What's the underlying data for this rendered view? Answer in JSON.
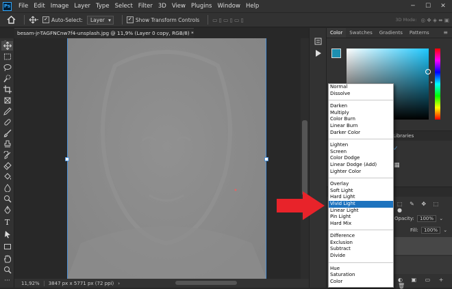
{
  "menubar": {
    "logo": "Ps",
    "items": [
      "File",
      "Edit",
      "Image",
      "Layer",
      "Type",
      "Select",
      "Filter",
      "3D",
      "View",
      "Plugins",
      "Window",
      "Help"
    ],
    "window_controls": [
      "─",
      "☐",
      "✕"
    ]
  },
  "options_bar": {
    "auto_select_label": "Auto-Select:",
    "layer_select": "Layer",
    "show_transform_label": "Show Transform Controls",
    "mode_3d_label": "3D Mode:"
  },
  "document": {
    "tab_title": "besam-jr-TAGFNCnw7f4-unsplash.jpg @ 11,9% (Layer 0 copy, RGB/8) *",
    "close": "×"
  },
  "status": {
    "zoom": "11,92%",
    "doc_size": "3847 px x 5771 px (72 ppi)"
  },
  "panels": {
    "color_tabs": [
      "Color",
      "Swatches",
      "Gradients",
      "Patterns"
    ],
    "libraries_tab": "Libraries",
    "opacity_label": "Opacity:",
    "opacity_value": "100%",
    "fill_label": "Fill:",
    "fill_value": "100%"
  },
  "colors": {
    "accent": "#1e73be",
    "foreground_swatch": "#1d8fb0",
    "arrow": "#e8232a"
  },
  "blend_menu": {
    "groups": [
      [
        "Normal",
        "Dissolve"
      ],
      [
        "Darken",
        "Multiply",
        "Color Burn",
        "Linear Burn",
        "Darker Color"
      ],
      [
        "Lighten",
        "Screen",
        "Color Dodge",
        "Linear Dodge (Add)",
        "Lighter Color"
      ],
      [
        "Overlay",
        "Soft Light",
        "Hard Light",
        "Vivid Light",
        "Linear Light",
        "Pin Light",
        "Hard Mix"
      ],
      [
        "Difference",
        "Exclusion",
        "Subtract",
        "Divide"
      ],
      [
        "Hue",
        "Saturation",
        "Color"
      ]
    ],
    "selected": "Vivid Light"
  }
}
